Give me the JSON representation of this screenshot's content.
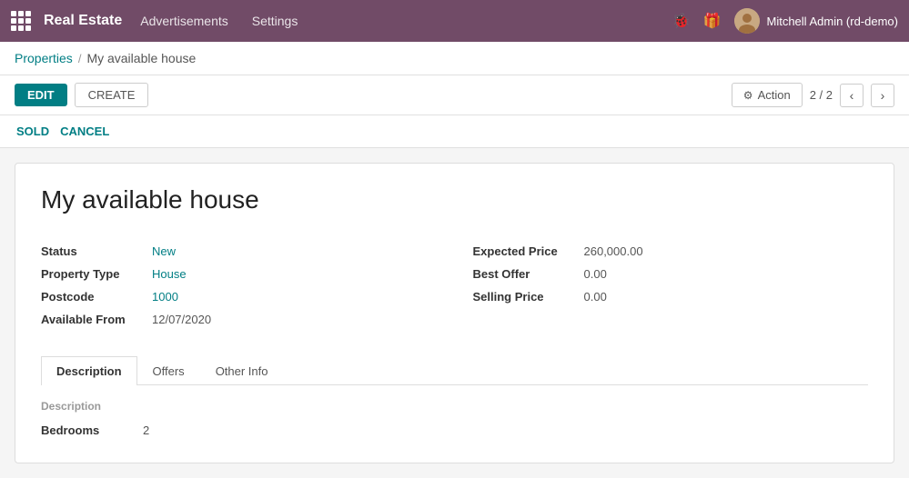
{
  "app": {
    "title": "Real Estate"
  },
  "nav": {
    "links": [
      {
        "label": "Advertisements"
      },
      {
        "label": "Settings"
      }
    ]
  },
  "user": {
    "name": "Mitchell Admin (rd-demo)"
  },
  "breadcrumb": {
    "parent": "Properties",
    "separator": "/",
    "current": "My available house"
  },
  "toolbar": {
    "edit_label": "EDIT",
    "create_label": "CREATE",
    "action_label": "Action",
    "pagination": "2 / 2"
  },
  "status_buttons": {
    "sold_label": "SOLD",
    "cancel_label": "CANCEL"
  },
  "record": {
    "title": "My available house",
    "fields_left": [
      {
        "label": "Status",
        "value": "New",
        "colored": true
      },
      {
        "label": "Property Type",
        "value": "House",
        "colored": true
      },
      {
        "label": "Postcode",
        "value": "1000",
        "colored": true
      },
      {
        "label": "Available From",
        "value": "12/07/2020",
        "colored": false
      }
    ],
    "fields_right": [
      {
        "label": "Expected Price",
        "value": "260,000.00",
        "colored": false
      },
      {
        "label": "Best Offer",
        "value": "0.00",
        "colored": false
      },
      {
        "label": "Selling Price",
        "value": "0.00",
        "colored": false
      }
    ]
  },
  "tabs": [
    {
      "label": "Description",
      "active": true
    },
    {
      "label": "Offers",
      "active": false
    },
    {
      "label": "Other Info",
      "active": false
    }
  ],
  "tab_content": {
    "description": {
      "section_label": "Description",
      "fields": [
        {
          "label": "Bedrooms",
          "value": "2"
        }
      ]
    }
  }
}
